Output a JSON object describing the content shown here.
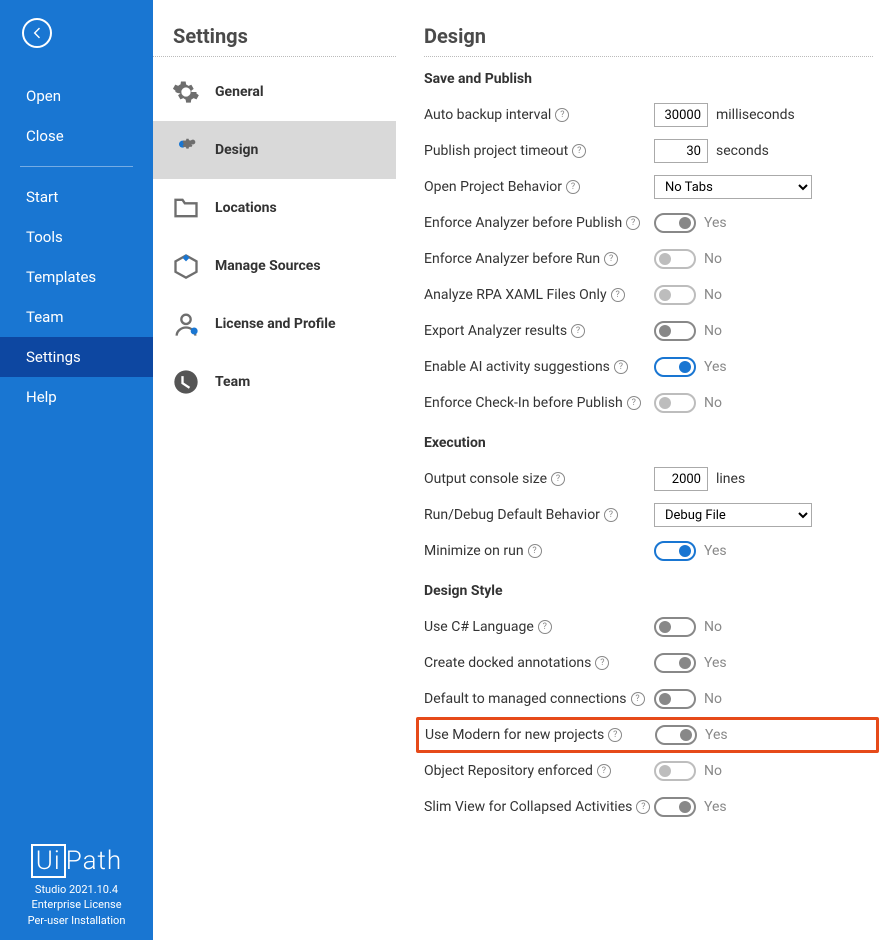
{
  "sidebar": {
    "items1": [
      "Open",
      "Close"
    ],
    "items2": [
      "Start",
      "Tools",
      "Templates",
      "Team",
      "Settings",
      "Help"
    ],
    "active": "Settings"
  },
  "brand": {
    "logo_ui": "Ui",
    "logo_path": "Path",
    "line1": "Studio 2021.10.4",
    "line2": "Enterprise License",
    "line3": "Per-user Installation"
  },
  "settings_nav": {
    "title": "Settings",
    "items": [
      {
        "label": "General"
      },
      {
        "label": "Design",
        "selected": true
      },
      {
        "label": "Locations"
      },
      {
        "label": "Manage Sources"
      },
      {
        "label": "License and Profile"
      },
      {
        "label": "Team"
      }
    ]
  },
  "design": {
    "title": "Design",
    "sections": {
      "save_publish": {
        "head": "Save and Publish",
        "auto_backup_label": "Auto backup interval",
        "auto_backup_value": "30000",
        "auto_backup_unit": "milliseconds",
        "publish_timeout_label": "Publish project timeout",
        "publish_timeout_value": "30",
        "publish_timeout_unit": "seconds",
        "open_project_label": "Open Project Behavior",
        "open_project_value": "No Tabs",
        "enforce_analyzer_publish_label": "Enforce Analyzer before Publish",
        "enforce_analyzer_publish_val": "Yes",
        "enforce_analyzer_run_label": "Enforce Analyzer before Run",
        "enforce_analyzer_run_val": "No",
        "analyze_rpa_label": "Analyze RPA XAML Files Only",
        "analyze_rpa_val": "No",
        "export_analyzer_label": "Export Analyzer results",
        "export_analyzer_val": "No",
        "enable_ai_label": "Enable AI activity suggestions",
        "enable_ai_val": "Yes",
        "enforce_checkin_label": "Enforce Check-In before Publish",
        "enforce_checkin_val": "No"
      },
      "execution": {
        "head": "Execution",
        "output_console_label": "Output console size",
        "output_console_value": "2000",
        "output_console_unit": "lines",
        "run_debug_label": "Run/Debug Default Behavior",
        "run_debug_value": "Debug File",
        "minimize_label": "Minimize on run",
        "minimize_val": "Yes"
      },
      "design_style": {
        "head": "Design Style",
        "csharp_label": "Use C# Language",
        "csharp_val": "No",
        "docked_label": "Create docked annotations",
        "docked_val": "Yes",
        "managed_conn_label": "Default to managed connections",
        "managed_conn_val": "No",
        "modern_label": "Use Modern for new projects",
        "modern_val": "Yes",
        "obj_repo_label": "Object Repository enforced",
        "obj_repo_val": "No",
        "slim_view_label": "Slim View for Collapsed Activities",
        "slim_view_val": "Yes"
      }
    }
  }
}
